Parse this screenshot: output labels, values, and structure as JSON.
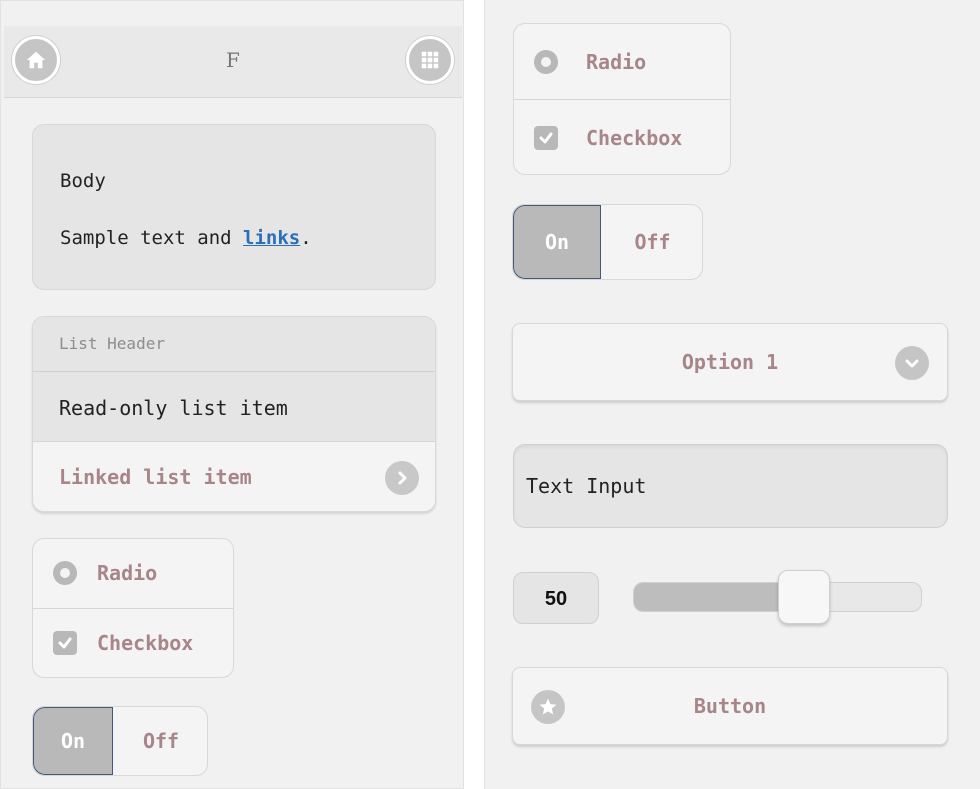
{
  "header": {
    "title": "F",
    "home_icon": "home-icon",
    "menu_icon": "grid-icon"
  },
  "body_card": {
    "heading": "Body",
    "text_before": "Sample text and ",
    "link_text": "links",
    "text_after": "."
  },
  "list": {
    "header": "List Header",
    "readonly_item": "Read-only list item",
    "linked_item": "Linked list item",
    "linked_icon": "chevron-right-icon"
  },
  "choices": {
    "radio_label": "Radio",
    "checkbox_label": "Checkbox"
  },
  "toggle": {
    "on_label": "On",
    "off_label": "Off"
  },
  "select": {
    "value": "Option 1",
    "icon": "chevron-down-icon"
  },
  "text_input": {
    "value": "Text Input"
  },
  "slider": {
    "value": "50",
    "min": 0,
    "max": 100
  },
  "button": {
    "label": "Button",
    "icon": "star-icon"
  },
  "colors": {
    "background": "#f1f1f1",
    "card": "#e5e5e5",
    "accent_text": "#a78588",
    "link": "#2a6fbb",
    "toggle_on": "#b9b9b9"
  }
}
